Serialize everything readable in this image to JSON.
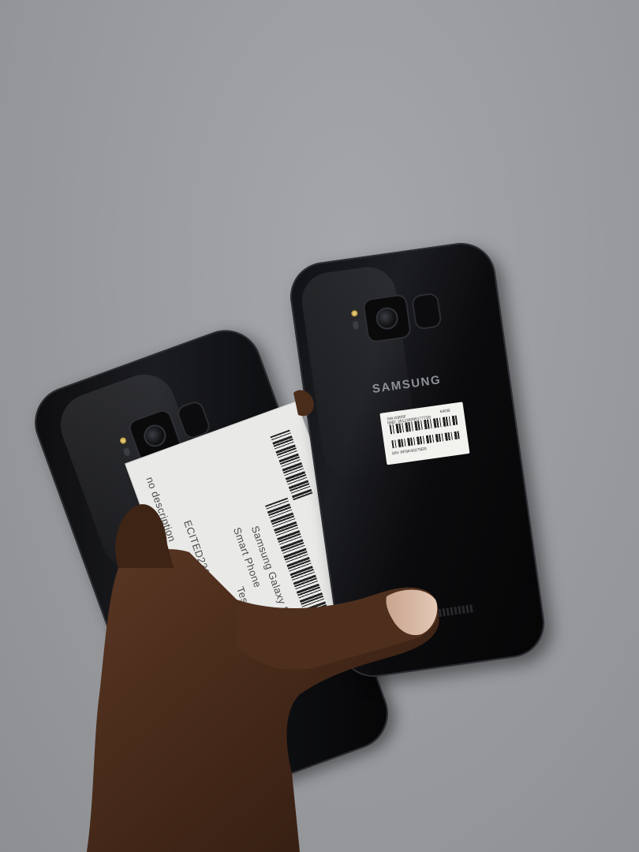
{
  "scene": {
    "description_colors": {
      "background": "#9a9ca0",
      "phone_body": "#0c0c0e",
      "label": "#e9eae8",
      "skin": "#4a2d1e"
    }
  },
  "front_phone": {
    "brand": "SAMSUNG",
    "sticker": {
      "model": "SM-G955F",
      "storage": "64GB",
      "imei": "IMEI: 3512360951777S8",
      "serial": "S/N: RF8K40275ER"
    },
    "icons": [
      "camera-icon",
      "fingerprint-sensor-icon",
      "flash-icon",
      "regulatory-marks-icon"
    ]
  },
  "back_phone": {
    "label": {
      "line1": "no description",
      "line2": "ECITED231757",
      "line3": "Test Exchang",
      "line4": "Smart Phone",
      "line5": "Samsung Galaxy S8+"
    },
    "icons": [
      "camera-icon",
      "fingerprint-sensor-icon",
      "flash-icon"
    ]
  }
}
